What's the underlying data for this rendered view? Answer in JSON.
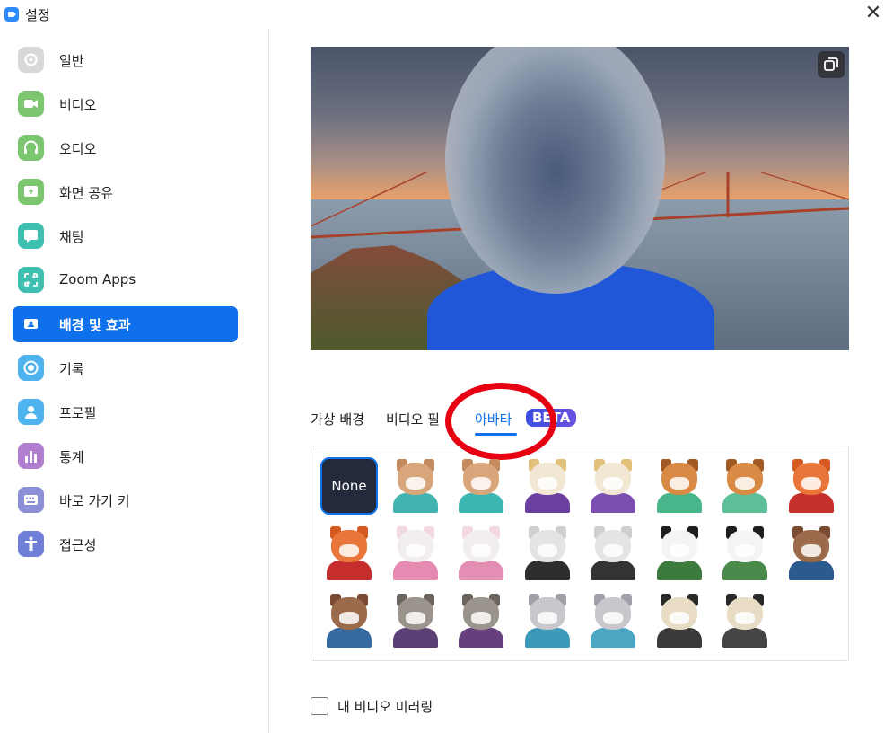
{
  "window": {
    "title": "설정"
  },
  "sidebar": {
    "items": [
      {
        "label": "일반",
        "icon": "gear-icon",
        "color": "#d8d8d8",
        "active": false
      },
      {
        "label": "비디오",
        "icon": "video-camera-icon",
        "color": "#7cc66f",
        "active": false
      },
      {
        "label": "오디오",
        "icon": "headphones-icon",
        "color": "#7cc66f",
        "active": false
      },
      {
        "label": "화면 공유",
        "icon": "share-screen-icon",
        "color": "#7cc66f",
        "active": false
      },
      {
        "label": "채팅",
        "icon": "chat-bubble-icon",
        "color": "#3fbfb0",
        "active": false
      },
      {
        "label": "Zoom Apps",
        "icon": "apps-icon",
        "color": "#3fbfb0",
        "active": false
      },
      {
        "label": "배경 및 효과",
        "icon": "person-card-icon",
        "color": "#0e71eb",
        "active": true
      },
      {
        "label": "기록",
        "icon": "record-icon",
        "color": "#4fb3f0",
        "active": false
      },
      {
        "label": "프로필",
        "icon": "profile-icon",
        "color": "#4fb3f0",
        "active": false
      },
      {
        "label": "통계",
        "icon": "bar-chart-icon",
        "color": "#b27fd0",
        "active": false
      },
      {
        "label": "바로 가기 키",
        "icon": "keyboard-icon",
        "color": "#8a8fd6",
        "active": false
      },
      {
        "label": "접근성",
        "icon": "accessibility-icon",
        "color": "#6f7fd8",
        "active": false
      }
    ]
  },
  "tabs": {
    "items": [
      {
        "label": "가상 배경"
      },
      {
        "label": "비디오 필"
      },
      {
        "label": "아바타"
      }
    ],
    "active": "아바타",
    "beta": "BETA"
  },
  "avatars": {
    "none_label": "None",
    "items": [
      {
        "name": "cat-avatar",
        "head": "#d9a57a",
        "body": "#43b3b0",
        "ear": "#c48b5e"
      },
      {
        "name": "cat-avatar",
        "head": "#d9a57a",
        "body": "#3bb6b0",
        "ear": "#c48b5e"
      },
      {
        "name": "cow-avatar",
        "head": "#f1e7d3",
        "body": "#6a3fa0",
        "ear": "#e2c17a"
      },
      {
        "name": "cow-avatar",
        "head": "#f1e7d3",
        "body": "#7a4fb0",
        "ear": "#e2c17a"
      },
      {
        "name": "dog-avatar",
        "head": "#d98b45",
        "body": "#48b58a",
        "ear": "#a25a25"
      },
      {
        "name": "dog-avatar",
        "head": "#d98b45",
        "body": "#5cbf98",
        "ear": "#a25a25"
      },
      {
        "name": "fox-avatar",
        "head": "#e8763a",
        "body": "#c6302a",
        "ear": "#d45a22"
      },
      {
        "name": "fox-avatar",
        "head": "#e8763a",
        "body": "#c62e2e",
        "ear": "#d45a22"
      },
      {
        "name": "rabbit-avatar",
        "head": "#f2eef0",
        "body": "#e58ab0",
        "ear": "#f2d8e2"
      },
      {
        "name": "rabbit-avatar",
        "head": "#f2eef0",
        "body": "#e48eb4",
        "ear": "#f2d8e2"
      },
      {
        "name": "hamster-avatar",
        "head": "#e4e4e4",
        "body": "#2e2e2e",
        "ear": "#cfcfcf"
      },
      {
        "name": "hamster-avatar",
        "head": "#e4e4e4",
        "body": "#333333",
        "ear": "#cfcfcf"
      },
      {
        "name": "panda-avatar",
        "head": "#f4f4f4",
        "body": "#3d7a3d",
        "ear": "#1e1e1e"
      },
      {
        "name": "panda-avatar",
        "head": "#f4f4f4",
        "body": "#4a8a4a",
        "ear": "#1e1e1e"
      },
      {
        "name": "beaver-avatar",
        "head": "#9a6a4a",
        "body": "#2b5a8e",
        "ear": "#7a4a32"
      },
      {
        "name": "beaver-avatar",
        "head": "#9a6a4a",
        "body": "#356aa0",
        "ear": "#7a4a32"
      },
      {
        "name": "raccoon-avatar",
        "head": "#9a948c",
        "body": "#5b3e74",
        "ear": "#6b6560"
      },
      {
        "name": "raccoon-avatar",
        "head": "#9a948c",
        "body": "#66407e",
        "ear": "#6b6560"
      },
      {
        "name": "grey-cat-avatar",
        "head": "#c8c8cc",
        "body": "#3c9ab8",
        "ear": "#a0a0a8"
      },
      {
        "name": "grey-cat-avatar",
        "head": "#c8c8cc",
        "body": "#4aa6c2",
        "ear": "#a0a0a8"
      },
      {
        "name": "cow-bw-avatar",
        "head": "#e8dcc4",
        "body": "#3a3a3a",
        "ear": "#2a2a2a"
      },
      {
        "name": "cow-bw-avatar",
        "head": "#e8dcc4",
        "body": "#444444",
        "ear": "#2a2a2a"
      }
    ]
  },
  "mirror": {
    "label": "내 비디오 미러링",
    "checked": false
  }
}
